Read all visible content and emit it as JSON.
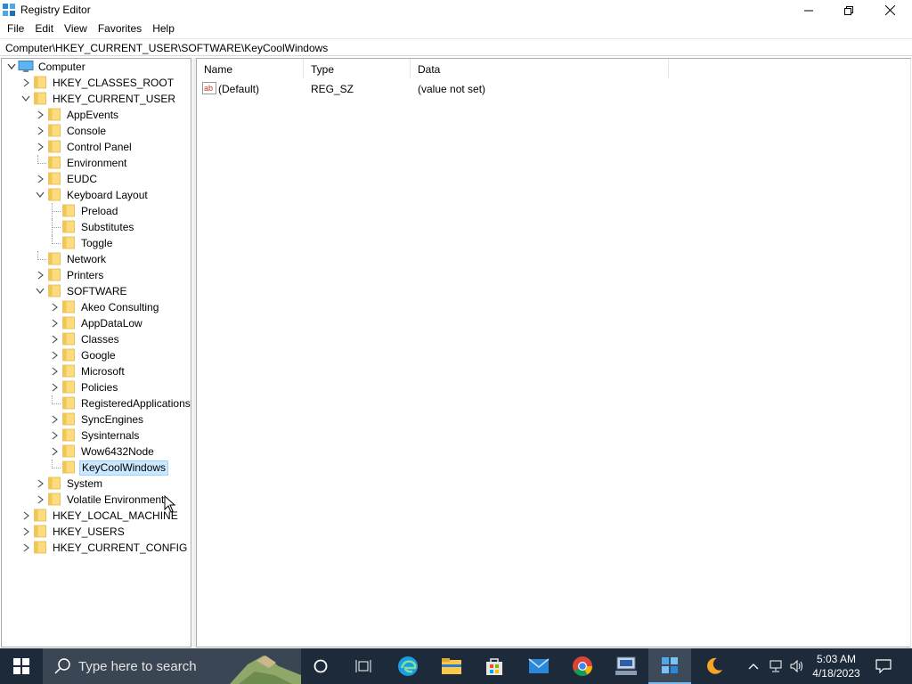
{
  "window": {
    "title": "Registry Editor",
    "icon": "registry-editor-icon",
    "controls": [
      "minimize-icon",
      "restore-icon",
      "close-icon"
    ]
  },
  "menu": [
    "File",
    "Edit",
    "View",
    "Favorites",
    "Help"
  ],
  "address": "Computer\\HKEY_CURRENT_USER\\SOFTWARE\\KeyCoolWindows",
  "tree": {
    "root": "Computer",
    "nodes": [
      {
        "label": "HKEY_CLASSES_ROOT"
      },
      {
        "label": "HKEY_CURRENT_USER",
        "expanded": true
      },
      {
        "label": "AppEvents"
      },
      {
        "label": "Console"
      },
      {
        "label": "Control Panel"
      },
      {
        "label": "Environment"
      },
      {
        "label": "EUDC"
      },
      {
        "label": "Keyboard Layout",
        "expanded": true
      },
      {
        "label": "Preload"
      },
      {
        "label": "Substitutes"
      },
      {
        "label": "Toggle"
      },
      {
        "label": "Network"
      },
      {
        "label": "Printers"
      },
      {
        "label": "SOFTWARE",
        "expanded": true
      },
      {
        "label": "Akeo Consulting"
      },
      {
        "label": "AppDataLow"
      },
      {
        "label": "Classes"
      },
      {
        "label": "Google"
      },
      {
        "label": "Microsoft"
      },
      {
        "label": "Policies"
      },
      {
        "label": "RegisteredApplications"
      },
      {
        "label": "SyncEngines"
      },
      {
        "label": "Sysinternals"
      },
      {
        "label": "Wow6432Node"
      },
      {
        "label": "KeyCoolWindows",
        "selected": true
      },
      {
        "label": "System"
      },
      {
        "label": "Volatile Environment"
      },
      {
        "label": "HKEY_LOCAL_MACHINE"
      },
      {
        "label": "HKEY_USERS"
      },
      {
        "label": "HKEY_CURRENT_CONFIG"
      }
    ]
  },
  "list": {
    "columns": [
      "Name",
      "Type",
      "Data"
    ],
    "rows": [
      {
        "name": "(Default)",
        "type": "REG_SZ",
        "data": "(value not set)",
        "icon": "string-value-icon"
      }
    ]
  },
  "taskbar": {
    "search_placeholder": "Type here to search",
    "apps": [
      "cortana-icon",
      "task-view-icon",
      "edge-icon",
      "file-explorer-icon",
      "store-icon",
      "mail-icon",
      "chrome-icon",
      "remote-desktop-icon",
      "registry-editor-icon",
      "night-light-icon"
    ],
    "active_app": "registry-editor-icon",
    "clock_time": "5:03 AM",
    "clock_date": "4/18/2023"
  }
}
